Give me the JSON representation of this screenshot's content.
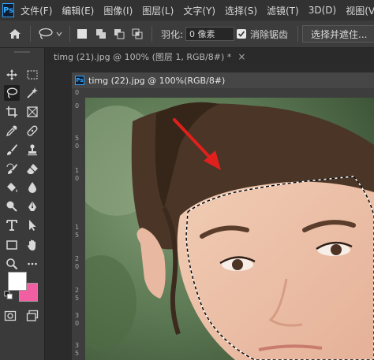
{
  "app": {
    "logo_text": "Ps"
  },
  "menu": [
    "文件(F)",
    "编辑(E)",
    "图像(I)",
    "图层(L)",
    "文字(Y)",
    "选择(S)",
    "滤镜(T)",
    "3D(D)",
    "视图(V)"
  ],
  "options": {
    "feather_label": "羽化:",
    "feather_value": "0 像素",
    "antialias_label": "消除锯齿",
    "select_mask_label": "选择并遮住..."
  },
  "tabs": {
    "background_tab": "timg (21).jpg @ 100% (图层 1, RGB/8#) *",
    "background_close": "×",
    "active_doc": "timg (22).jpg @ 100%(RGB/8#)"
  },
  "rulers": {
    "top": [
      "0"
    ],
    "left": [
      "0",
      "5",
      "0",
      "1",
      "0",
      "1",
      "5",
      "2",
      "0",
      "2",
      "5",
      "3",
      "0",
      "3",
      "5"
    ]
  },
  "colors": {
    "foreground": "#ffffff",
    "background": "#f15fa2",
    "annotation_arrow": "#e0201c"
  },
  "tools": [
    "move-tool",
    "marquee-tool",
    "lasso-tool",
    "magic-wand-tool",
    "crop-tool",
    "frame-tool",
    "eyedropper-tool",
    "healing-brush-tool",
    "brush-tool",
    "clone-stamp-tool",
    "history-brush-tool",
    "eraser-tool",
    "paint-bucket-tool",
    "blur-tool",
    "dodge-tool",
    "pen-tool",
    "type-tool",
    "path-selection-tool",
    "rectangle-tool",
    "custom-shape-tool",
    "zoom-tool",
    "more-tools"
  ]
}
